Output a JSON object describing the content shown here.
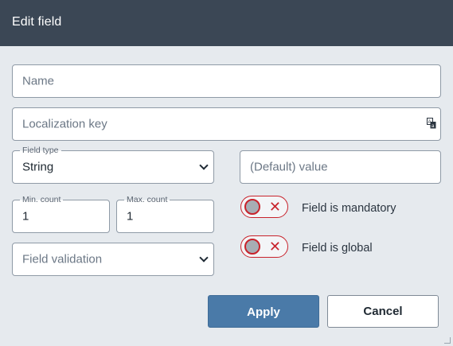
{
  "dialog": {
    "title": "Edit field"
  },
  "name": {
    "placeholder": "Name"
  },
  "localization_key": {
    "placeholder": "Localization key",
    "icon": "translate-icon"
  },
  "field_type": {
    "label": "Field type",
    "value": "String"
  },
  "default_value": {
    "placeholder": "(Default) value"
  },
  "min_count": {
    "label": "Min. count",
    "value": "1"
  },
  "max_count": {
    "label": "Max. count",
    "value": "1"
  },
  "validation": {
    "placeholder": "Field validation"
  },
  "toggles": {
    "mandatory": {
      "label": "Field is mandatory",
      "state": "off"
    },
    "global": {
      "label": "Field is global",
      "state": "off"
    }
  },
  "buttons": {
    "apply": "Apply",
    "cancel": "Cancel"
  },
  "colors": {
    "header": "#3b4755",
    "apply": "#4a7aa8",
    "toggle_off": "#c8232c"
  }
}
